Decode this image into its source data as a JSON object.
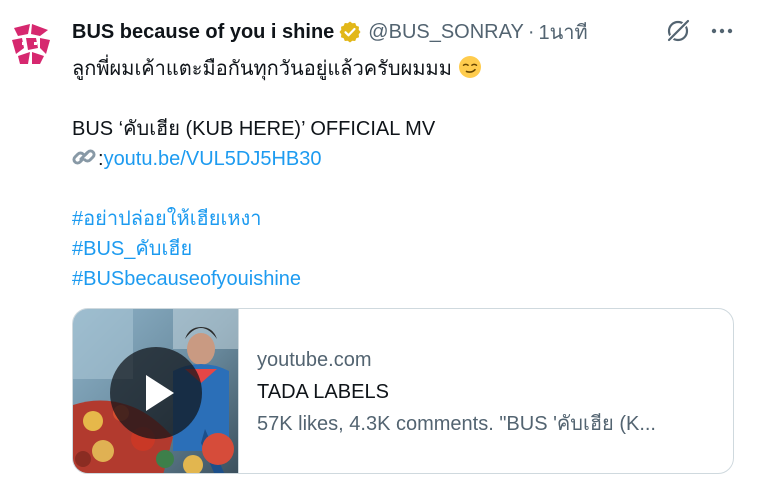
{
  "author": {
    "name": "BUS because of you i shine",
    "handle": "@BUS_SONRAY",
    "separator": "·",
    "time": "1นาที"
  },
  "tweet": {
    "line1": "ลูกพี่ผมเค้าแตะมือกันทุกวันอยู่แล้วครับผมมม",
    "line1_emoji": "smirking-face-emoji",
    "title_line": "BUS ‘คับเฮีย (KUB HERE)’ OFFICIAL MV",
    "link_prefix": ":",
    "link_text": "youtu.be/VUL5DJ5HB30",
    "hashtags": [
      "#อย่าปล่อยให้เฮียเหงา",
      "#BUS_คับเฮีย",
      "#BUSbecauseofyouishine"
    ]
  },
  "card": {
    "domain": "youtube.com",
    "title": "TADA LABELS",
    "description": "57K likes, 4.3K comments. \"BUS 'คับเฮีย (K..."
  },
  "colors": {
    "link": "#1d9bf0",
    "verified": "#e2b719",
    "muted": "#536471",
    "logo": "#d6286f"
  }
}
